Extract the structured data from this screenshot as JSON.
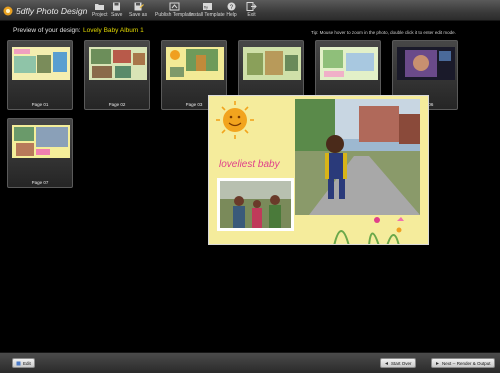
{
  "app": {
    "title": "5dfly Photo Design"
  },
  "toolbar": {
    "items": [
      {
        "label": "Project",
        "icon": "folder-icon"
      },
      {
        "label": "Save",
        "icon": "save-icon"
      },
      {
        "label": "Save as",
        "icon": "save-as-icon"
      },
      {
        "label": "Publish Template",
        "icon": "publish-template-icon"
      },
      {
        "label": "Install Template",
        "icon": "install-template-icon"
      },
      {
        "label": "Help",
        "icon": "help-icon"
      },
      {
        "label": "Exit",
        "icon": "exit-icon"
      }
    ]
  },
  "preview": {
    "label": "Preview of your design:",
    "album_name": "Lovely Baby Album 1",
    "tip": "Tip: Mouse hover to zoom in the photo, double click it to enter edit mode."
  },
  "pages": [
    {
      "label": "Page 01"
    },
    {
      "label": "Page 02"
    },
    {
      "label": "Page 03"
    },
    {
      "label": "Page 04"
    },
    {
      "label": "Page 05"
    },
    {
      "label": "Page 06"
    },
    {
      "label": "Page 07"
    }
  ],
  "zoom_preview": {
    "caption": "loveliest baby"
  },
  "bottom": {
    "edit_label": "Edit",
    "start_over_label": "Start Over",
    "next_label": "Next -- Render & Output"
  },
  "colors": {
    "accent_yellow": "#e2d800",
    "background": "#000000",
    "toolbar": "#3a3a3a",
    "caption_pink": "#e0408a"
  }
}
